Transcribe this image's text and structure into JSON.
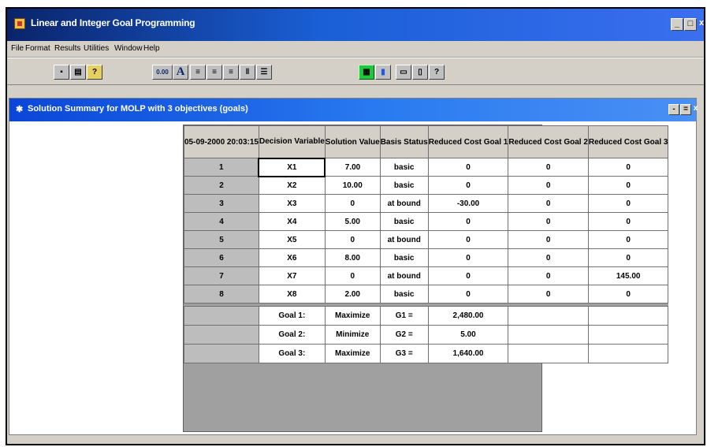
{
  "app": {
    "title": "Linear and Integer Goal Programming",
    "window_buttons": [
      "_",
      "□",
      "x"
    ]
  },
  "menu": [
    "File",
    "Format",
    "Results",
    "Utilities",
    "Window",
    "Help"
  ],
  "toolbar": {
    "buttons": [
      {
        "icon": "save-icon",
        "glyph": "▪"
      },
      {
        "icon": "print-icon",
        "glyph": "▤"
      },
      {
        "icon": "help-icon",
        "glyph": "?"
      },
      {
        "icon": "number-format-icon",
        "glyph": "0.00"
      },
      {
        "icon": "font-icon",
        "glyph": "A"
      },
      {
        "icon": "align-left-icon",
        "glyph": "≡"
      },
      {
        "icon": "align-center-icon",
        "glyph": "≡"
      },
      {
        "icon": "align-right-icon",
        "glyph": "≡"
      },
      {
        "icon": "column-width-icon",
        "glyph": "‖"
      },
      {
        "icon": "row-height-icon",
        "glyph": "☰"
      },
      {
        "icon": "grid-icon",
        "glyph": "▦"
      },
      {
        "icon": "bar-chart-icon",
        "glyph": "▮"
      },
      {
        "icon": "copy-icon",
        "glyph": "▭"
      },
      {
        "icon": "paste-icon",
        "glyph": "▯"
      },
      {
        "icon": "info-icon",
        "glyph": "?"
      }
    ]
  },
  "child_window": {
    "title": "Solution Summary for MOLP with 3 objectives (goals)",
    "buttons": [
      "-",
      "=",
      "x"
    ]
  },
  "table": {
    "corner": "05-09-2000 20:03:15",
    "headers": [
      "Decision Variable",
      "Solution Value",
      "Basis Status",
      "Reduced Cost Goal 1",
      "Reduced Cost Goal 2",
      "Reduced Cost Goal 3"
    ],
    "rows": [
      {
        "n": "1",
        "cells": [
          "X1",
          "7.00",
          "basic",
          "0",
          "0",
          "0"
        ]
      },
      {
        "n": "2",
        "cells": [
          "X2",
          "10.00",
          "basic",
          "0",
          "0",
          "0"
        ]
      },
      {
        "n": "3",
        "cells": [
          "X3",
          "0",
          "at bound",
          "-30.00",
          "0",
          "0"
        ]
      },
      {
        "n": "4",
        "cells": [
          "X4",
          "5.00",
          "basic",
          "0",
          "0",
          "0"
        ]
      },
      {
        "n": "5",
        "cells": [
          "X5",
          "0",
          "at bound",
          "0",
          "0",
          "0"
        ]
      },
      {
        "n": "6",
        "cells": [
          "X6",
          "8.00",
          "basic",
          "0",
          "0",
          "0"
        ]
      },
      {
        "n": "7",
        "cells": [
          "X7",
          "0",
          "at bound",
          "0",
          "0",
          "145.00"
        ]
      },
      {
        "n": "8",
        "cells": [
          "X8",
          "2.00",
          "basic",
          "0",
          "0",
          "0"
        ]
      }
    ],
    "goals": [
      {
        "label": "Goal 1:",
        "sense": "Maximize",
        "name": "G1 =",
        "value": "2,480.00"
      },
      {
        "label": "Goal 2:",
        "sense": "Minimize",
        "name": "G2 =",
        "value": "5.00"
      },
      {
        "label": "Goal 3:",
        "sense": "Maximize",
        "name": "G3 =",
        "value": "1,640.00"
      }
    ]
  }
}
